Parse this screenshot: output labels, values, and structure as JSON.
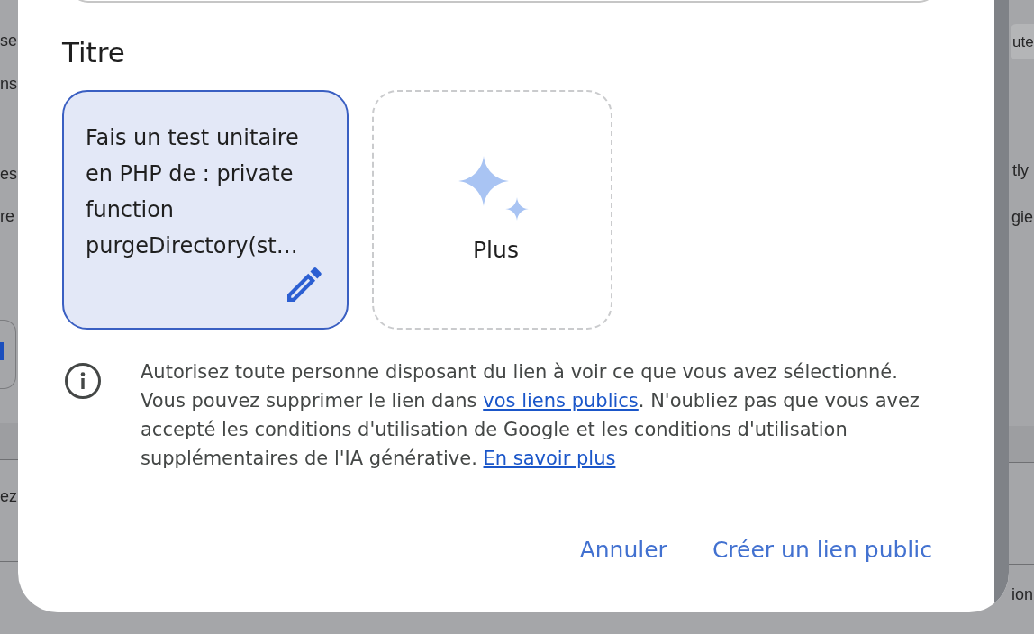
{
  "background": {
    "left_fragments": [
      "se",
      "ns",
      "es",
      "re",
      "ez"
    ],
    "right_fragments": [
      "ute",
      "tly",
      "gie",
      "ion"
    ]
  },
  "dialog": {
    "section_title": "Titre",
    "cards": [
      {
        "kind": "prompt",
        "text": "Fais un test unitaire en PHP de : private function purgeDirectory(st…",
        "selected": true
      },
      {
        "kind": "more",
        "label": "Plus",
        "selected": false
      }
    ],
    "notice": {
      "segments": [
        {
          "kind": "text",
          "text": "Autorisez toute personne disposant du lien à voir ce que vous avez sélectionné. Vous pouvez supprimer le lien dans "
        },
        {
          "kind": "link",
          "text": "vos liens publics"
        },
        {
          "kind": "text",
          "text": ". N'oubliez pas que vous avez accepté les conditions d'utilisation de Google et les conditions d'utilisation supplémentaires de l'IA générative. "
        },
        {
          "kind": "link",
          "text": "En savoir plus"
        }
      ]
    },
    "buttons": [
      {
        "label": "Annuler"
      },
      {
        "label": "Créer un lien public"
      }
    ]
  }
}
